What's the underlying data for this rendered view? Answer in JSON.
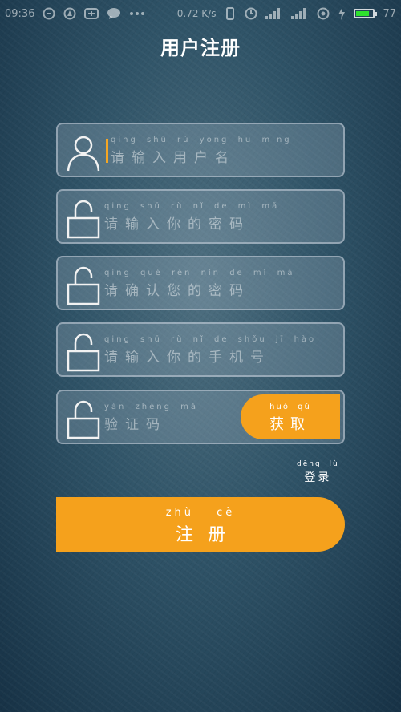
{
  "status_bar": {
    "time": "09:36",
    "net_speed": "0.72 K/s",
    "battery_level": "77",
    "battery_color": "#2ee02e",
    "left_icons": [
      "circle-icon",
      "compass-icon",
      "taobao-icon",
      "chat-icon",
      "more-icon"
    ],
    "right_icons": [
      "vibrate-icon",
      "clock-icon",
      "signal-icon",
      "signal-icon",
      "wifi-icon",
      "charging-icon",
      "battery-icon"
    ]
  },
  "header": {
    "title": "用户注册"
  },
  "fields": {
    "username": {
      "pinyin": "qing shū rù yong hu ming",
      "label": "请输入用户名",
      "icon": "user-icon"
    },
    "password": {
      "pinyin": "qing shū rù nǐ de mì mǎ",
      "label": "请输入你的密码",
      "icon": "lock-icon"
    },
    "confirm_password": {
      "pinyin": "qing què rèn nín de mì mǎ",
      "label": "请确认您的密码",
      "icon": "lock-icon"
    },
    "phone": {
      "pinyin": "qing shū rù nǐ de shǒu jī hào",
      "label": "请输入你的手机号",
      "icon": "lock-icon"
    },
    "code": {
      "pinyin": "yàn zhèng mǎ",
      "label": "验证码",
      "icon": "lock-icon"
    }
  },
  "get_code_button": {
    "pinyin": "huò qǔ",
    "label": "获取"
  },
  "login_link": {
    "pinyin": "dēng lù",
    "label": "登录"
  },
  "register_button": {
    "pinyin": "zhù cè",
    "label": "注册"
  },
  "colors": {
    "accent": "#f5a11c",
    "cursor": "#f5a623"
  }
}
